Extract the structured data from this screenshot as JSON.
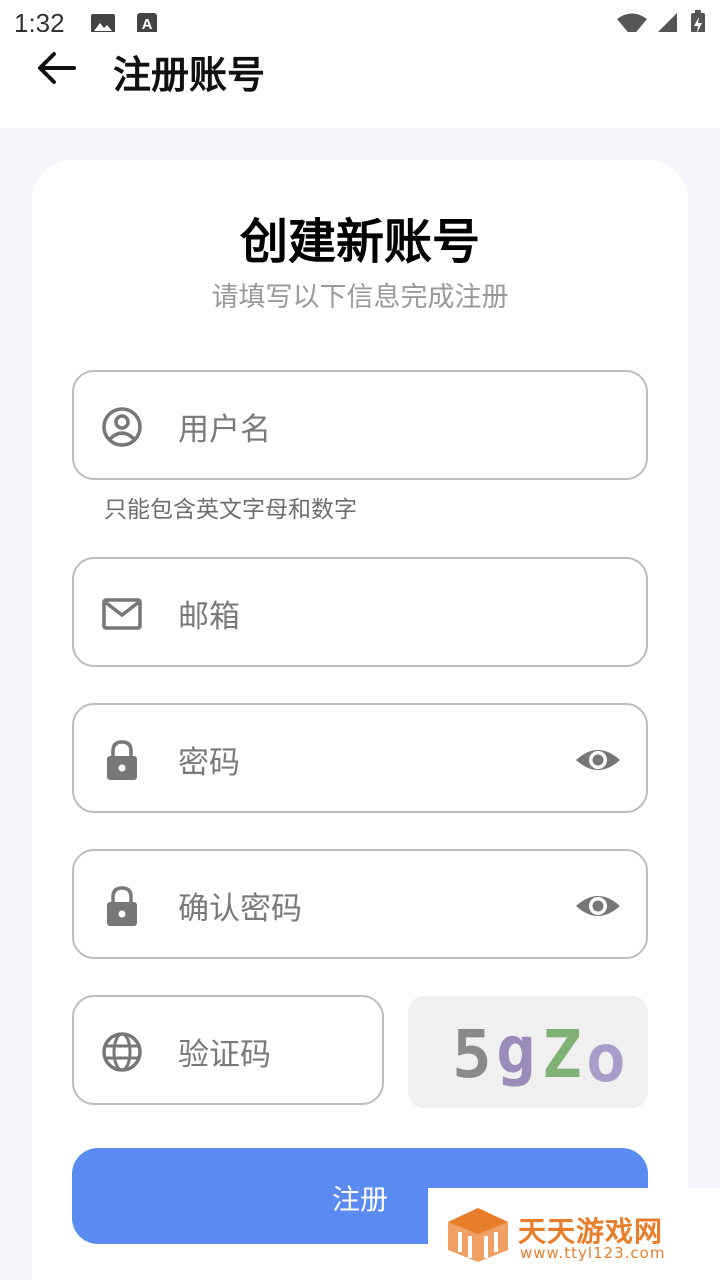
{
  "status_bar": {
    "time": "1:32",
    "icons": [
      "image-icon",
      "a-notification-icon",
      "wifi-icon",
      "signal-icon",
      "battery-charging-icon"
    ]
  },
  "app_bar": {
    "back_icon": "arrow-left-icon",
    "title": "注册账号"
  },
  "card": {
    "title": "创建新账号",
    "subtitle": "请填写以下信息完成注册"
  },
  "form": {
    "username": {
      "placeholder": "用户名",
      "icon": "account-circle-icon",
      "helper": "只能包含英文字母和数字"
    },
    "email": {
      "placeholder": "邮箱",
      "icon": "mail-icon"
    },
    "password": {
      "placeholder": "密码",
      "icon": "lock-icon",
      "toggle_icon": "eye-icon"
    },
    "confirm_password": {
      "placeholder": "确认密码",
      "icon": "lock-icon",
      "toggle_icon": "eye-icon"
    },
    "captcha": {
      "placeholder": "验证码",
      "icon": "globe-icon",
      "image_text": [
        "5",
        "g",
        "Z",
        "o"
      ]
    },
    "submit_label": "注册"
  },
  "colors": {
    "accent": "#5b8af3",
    "background": "#f5f6fb",
    "watermark": "#e87d2a"
  },
  "watermark": {
    "name": "天天游戏网",
    "url": "www.ttyl123.com"
  }
}
